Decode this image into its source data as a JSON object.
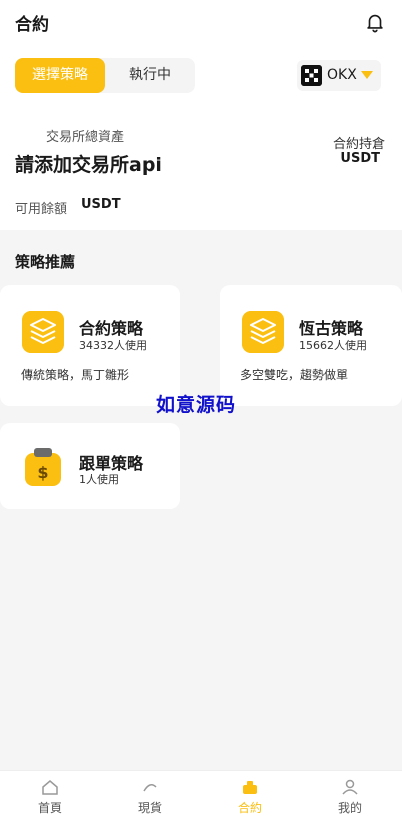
{
  "header": {
    "title": "合約",
    "bell_icon": "bell-icon"
  },
  "mode_tabs": [
    {
      "label": "選擇策略",
      "active": true
    },
    {
      "label": "執行中",
      "active": false
    }
  ],
  "exchange_selector": {
    "name": "OKX",
    "logo_icon": "okx-logo-icon",
    "caret_icon": "caret-down-icon"
  },
  "account": {
    "total_assets_label": "交易所總資產",
    "total_assets_value": "請添加交易所api",
    "position_label": "合約持倉",
    "position_unit": "USDT",
    "available_label": "可用餘額",
    "available_unit": "USDT"
  },
  "strategies": {
    "section_title": "策略推薦",
    "items": [
      {
        "name": "合約策略",
        "users": "34332人使用",
        "desc": "傳統策略，馬丁雛形",
        "icon": "layers-icon"
      },
      {
        "name": "恆古策略",
        "users": "15662人使用",
        "desc": "多空雙吃，趨勢做單",
        "icon": "layers-icon"
      },
      {
        "name": "跟單策略",
        "users": "1人使用",
        "icon": "dollar-bag-icon"
      }
    ]
  },
  "watermark": "如意源码",
  "bottom_nav": [
    {
      "label": "首頁",
      "icon": "home-icon",
      "active": false
    },
    {
      "label": "現貨",
      "icon": "spot-icon",
      "active": false
    },
    {
      "label": "合約",
      "icon": "contract-icon",
      "active": true
    },
    {
      "label": "我的",
      "icon": "profile-icon",
      "active": false
    }
  ],
  "colors": {
    "accent": "#fbbf12",
    "background_gray": "#f5f5f5",
    "watermark": "#1111cc"
  }
}
